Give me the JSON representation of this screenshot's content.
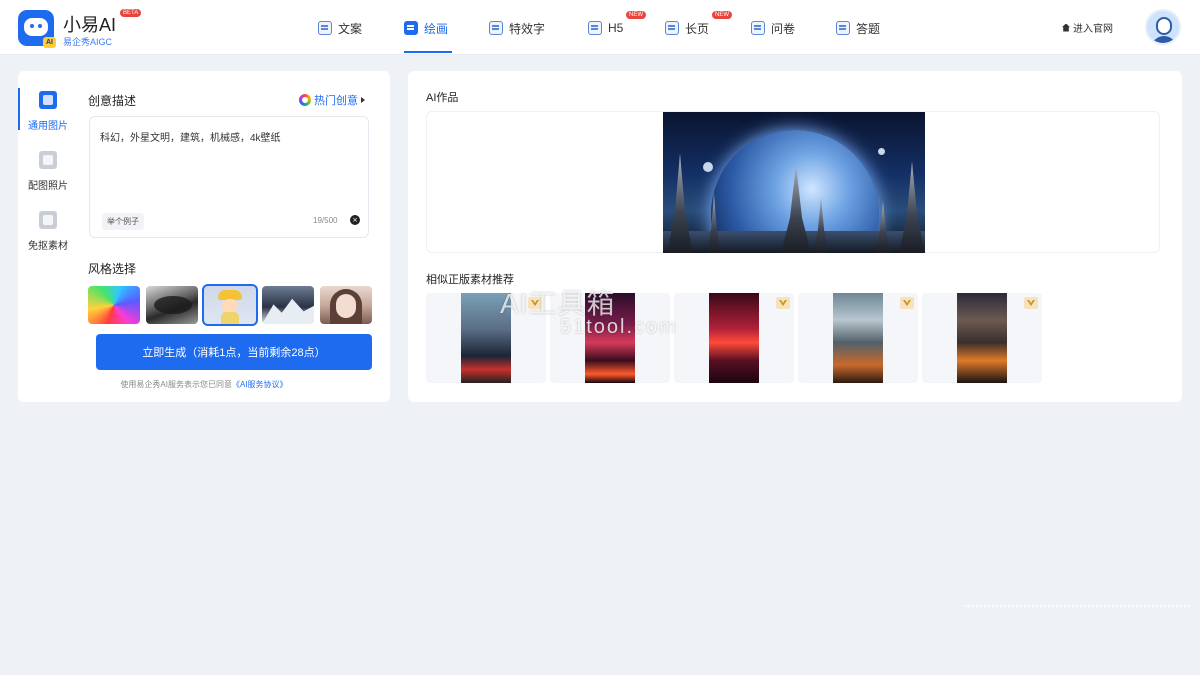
{
  "brand": {
    "name": "小易AI",
    "beta": "BETA",
    "subtitle": "易企秀AIGC",
    "icon_badge": "AI"
  },
  "nav": [
    {
      "label": "文案",
      "badge": ""
    },
    {
      "label": "绘画",
      "badge": ""
    },
    {
      "label": "特效字",
      "badge": ""
    },
    {
      "label": "H5",
      "badge": "NEW"
    },
    {
      "label": "长页",
      "badge": "NEW"
    },
    {
      "label": "问卷",
      "badge": ""
    },
    {
      "label": "答题",
      "badge": ""
    }
  ],
  "header_right": {
    "enter_site": "进入官网"
  },
  "sidebar": {
    "items": [
      {
        "label": "通用图片",
        "icon": "image-icon"
      },
      {
        "label": "配图照片",
        "icon": "photo-icon"
      },
      {
        "label": "免抠素材",
        "icon": "cutout-icon"
      }
    ]
  },
  "creative": {
    "title": "创意描述",
    "hot_label": "热门创意",
    "prompt_value": "科幻，外星文明，建筑，机械感，4k壁纸",
    "example_label": "举个例子",
    "counter": "19/500"
  },
  "style": {
    "title": "风格选择",
    "options": [
      "rainbow",
      "black-white",
      "cute-3d",
      "mountain",
      "portrait"
    ],
    "selected": "cute-3d"
  },
  "generate": {
    "button_label": "立即生成（消耗1点，当前剩余28点）",
    "agreement_prefix": "使用易企秀AI服务表示您已同意",
    "agreement_link": "《AI服务协议》"
  },
  "result": {
    "title": "AI作品"
  },
  "recommend": {
    "title": "相似正版素材推荐"
  },
  "watermark": {
    "line1": "AI工具箱",
    "line2": "51tool.com"
  },
  "colors": {
    "accent": "#1f6bf0",
    "badge_red": "#e8453c",
    "background": "#eef1f5"
  }
}
